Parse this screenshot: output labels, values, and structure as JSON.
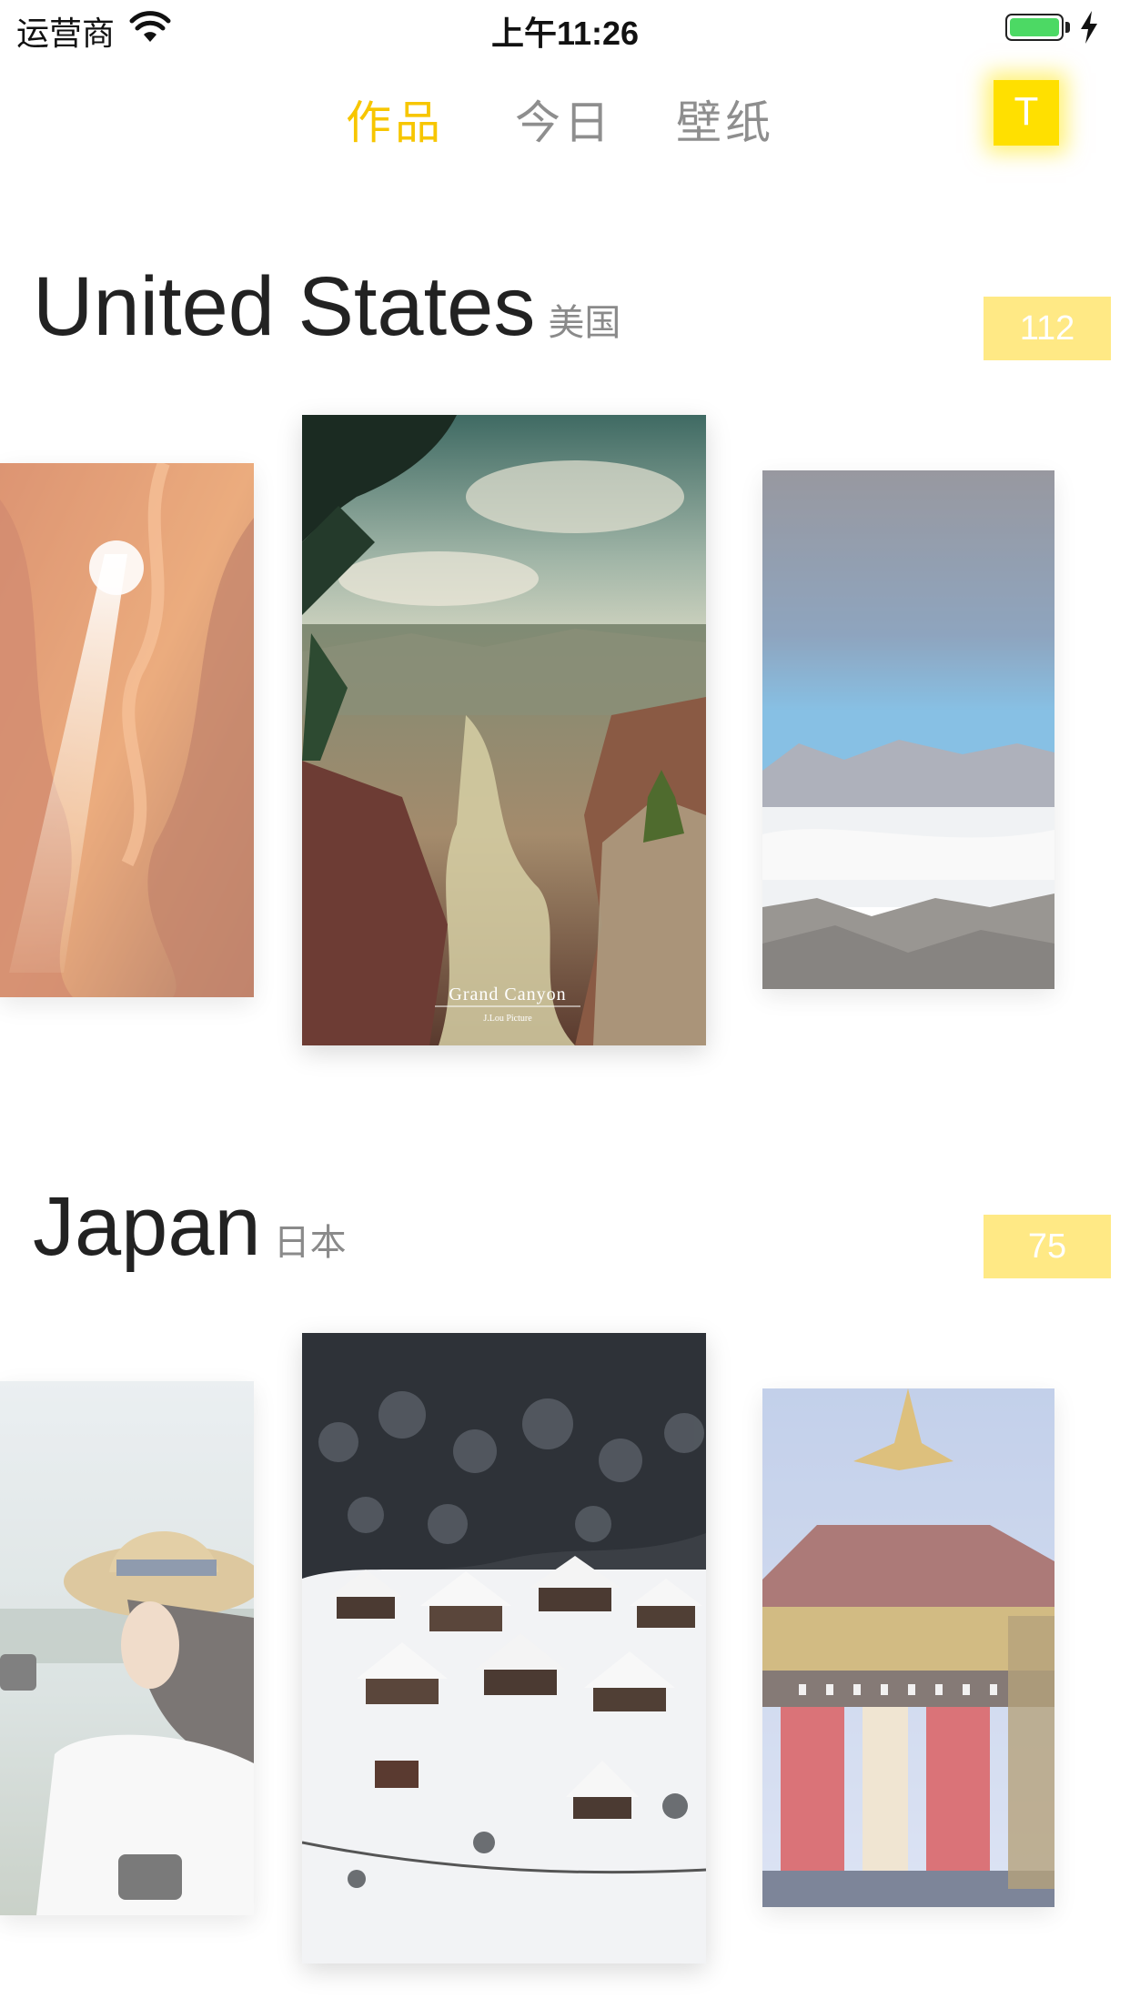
{
  "status_bar": {
    "carrier": "运营商",
    "time": "上午11:26",
    "battery_level": 1.0,
    "wifi_icon": "wifi-icon",
    "charging_icon": "charging-bolt-icon"
  },
  "nav": {
    "tabs": [
      {
        "label": "作品",
        "active": true
      },
      {
        "label": "今日",
        "active": false
      },
      {
        "label": "壁纸",
        "active": false
      }
    ],
    "avatar_letter": "T"
  },
  "colors": {
    "accent": "#f7c600",
    "avatar_bg": "#ffe000",
    "badge_bg": "#ffe985"
  },
  "sections": [
    {
      "title": "United States",
      "subtitle": "美国",
      "count": "112",
      "cards": [
        {
          "name": "antelope-canyon-photo"
        },
        {
          "name": "grand-canyon-photo",
          "caption": "Grand Canyon",
          "credit": "J.Lou Picture"
        },
        {
          "name": "death-valley-photo"
        }
      ]
    },
    {
      "title": "Japan",
      "subtitle": "日本",
      "count": "75",
      "cards": [
        {
          "name": "woman-with-hat-photo"
        },
        {
          "name": "snowy-village-photo"
        },
        {
          "name": "festival-float-photo"
        }
      ]
    }
  ]
}
